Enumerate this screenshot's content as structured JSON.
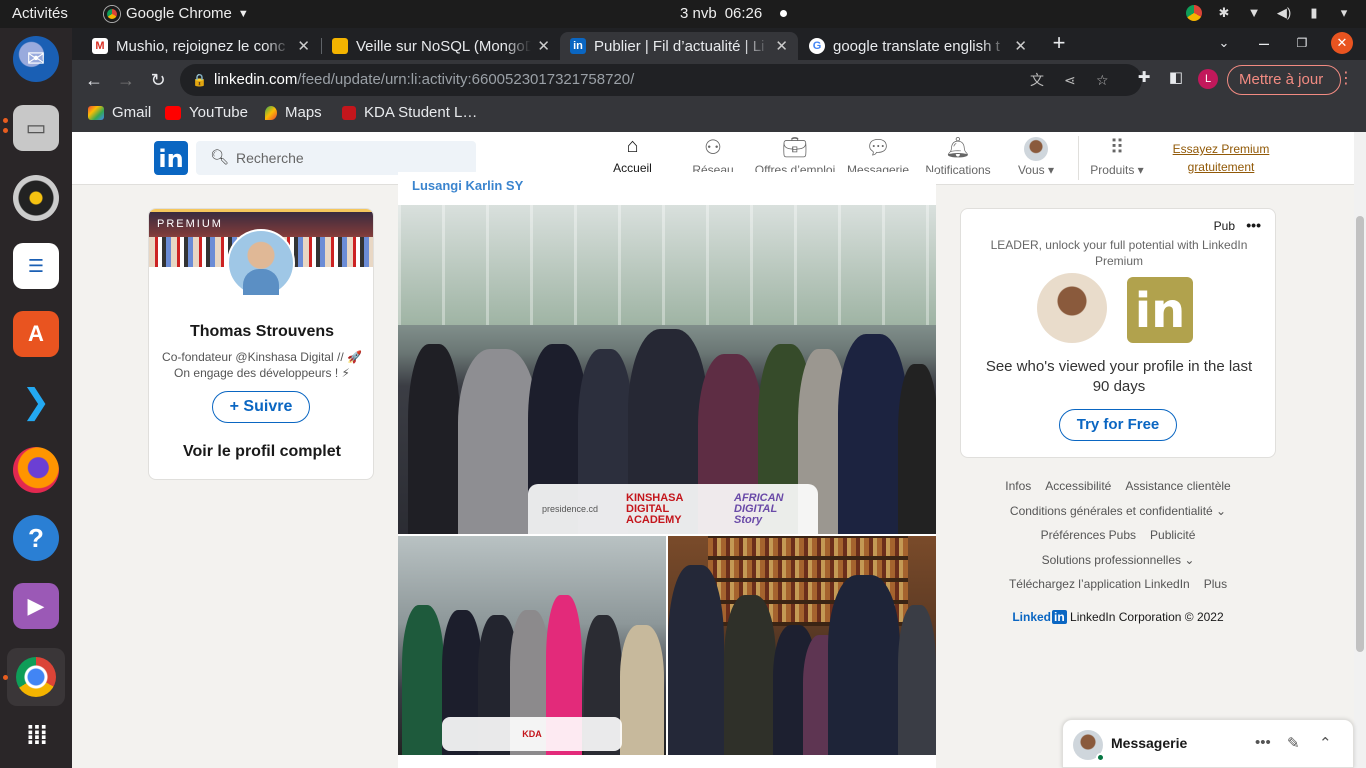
{
  "system_bar": {
    "activities": "Activités",
    "app_name": "Google Chrome",
    "date": "3 nvb",
    "time": "06:26"
  },
  "dock": {
    "items": [
      "thunderbird-icon",
      "files-icon",
      "rhythmbox-icon",
      "writer-icon",
      "app-center-icon",
      "vscode-icon",
      "firefox-icon",
      "help-icon",
      "video-icon",
      "chrome-icon",
      "app-grid-icon"
    ]
  },
  "browser": {
    "tabs": [
      {
        "title": "Mushio, rejoignez le conc",
        "favicon": "gmail"
      },
      {
        "title": "Veille sur NoSQL (MongoD",
        "favicon": "slides"
      },
      {
        "title": "Publier | Fil d’actualité | Li",
        "favicon": "linkedin"
      },
      {
        "title": "google translate english t",
        "favicon": "google"
      }
    ],
    "url_host": "linkedin.com",
    "url_path": "/feed/update/urn:li:activity:6600523017321758720/",
    "profile_initial": "L",
    "update_label": "Mettre à jour",
    "bookmarks": [
      "Gmail",
      "YouTube",
      "Maps",
      "KDA Student L…"
    ]
  },
  "linkedin": {
    "search_placeholder": "Recherche",
    "nav": [
      "Accueil",
      "Réseau",
      "Offres d’emploi",
      "Messagerie",
      "Notifications",
      "Vous",
      "Produits"
    ],
    "premium_link": "Essayez Premium gratuitement",
    "profile": {
      "badge": "PREMIUM",
      "name": "Thomas Strouvens",
      "headline": "Co-fondateur @Kinshasa Digital // 🚀 On engage des développeurs ! ⚡",
      "follow_label": "+ Suivre",
      "full_profile": "Voir le profil complet"
    },
    "post": {
      "author": "Lusangi Karlin SY",
      "logos": [
        "presidence.cd",
        "KINSHASA DIGITAL ACADEMY",
        "AFRICAN DIGITAL Story"
      ]
    },
    "ad": {
      "pub_label": "Pub",
      "top_text": "LEADER, unlock your full potential with LinkedIn Premium",
      "main_text": "See who's viewed your profile in the last 90 days",
      "cta": "Try for Free"
    },
    "footer_lines": [
      [
        "Infos",
        "Accessibilité",
        "Assistance clientèle"
      ],
      [
        "Conditions générales et confidentialité ⌄"
      ],
      [
        "Préférences Pubs",
        "Publicité"
      ],
      [
        "Solutions professionnelles ⌄"
      ],
      [
        "Téléchargez l’application LinkedIn",
        "Plus"
      ]
    ],
    "copyright": "LinkedIn Corporation © 2022",
    "messaging_label": "Messagerie"
  }
}
